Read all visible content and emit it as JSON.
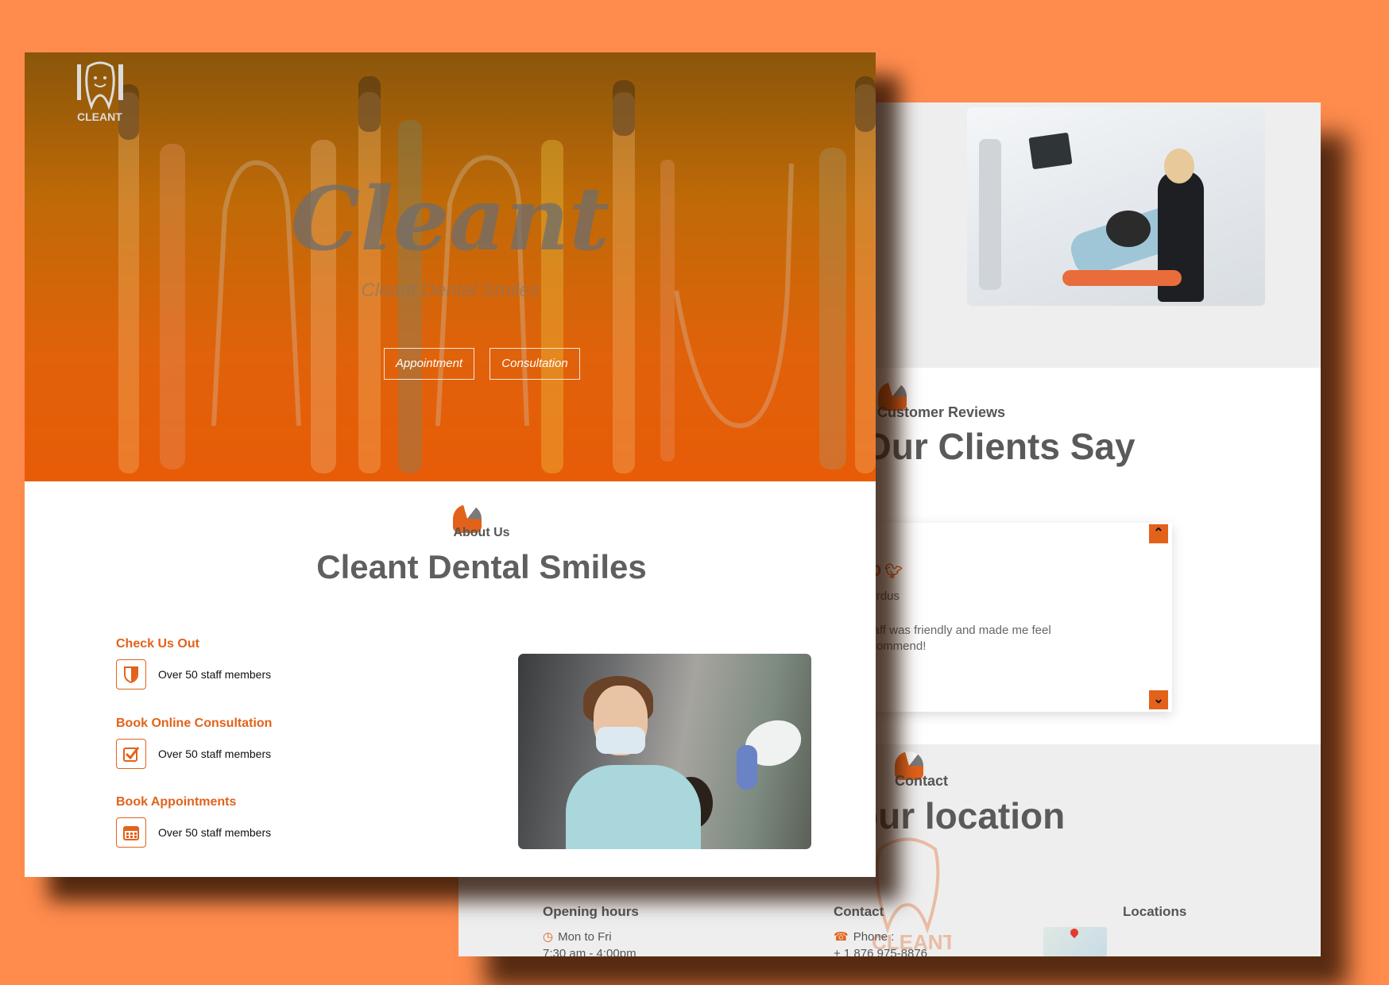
{
  "colors": {
    "background": "#ff8c4d",
    "accent": "#e2621b",
    "heading": "#5f5f5f"
  },
  "front": {
    "logo_text": "CLEANT",
    "hero": {
      "title": "Cleant",
      "subtitle": "Cleant Dental Smiles",
      "buttons": [
        "Appointment",
        "Consultation"
      ]
    },
    "about": {
      "label": "About Us",
      "title": "Cleant Dental Smiles",
      "features": [
        {
          "heading": "Check Us Out",
          "text": "Over 50 staff members",
          "icon": "shield-icon"
        },
        {
          "heading": "Book Online Consultation",
          "text": "Over 50 staff members",
          "icon": "checkbox-icon"
        },
        {
          "heading": "Book Appointments",
          "text": "Over 50 staff members",
          "icon": "calendar-icon"
        }
      ]
    }
  },
  "back": {
    "reviews": {
      "label": "Customer Reviews",
      "title": "Our Clients Say",
      "card": {
        "handle": "rD",
        "username": "ecrdus",
        "text": "staff was friendly and made me feel ecommend!"
      }
    },
    "contact": {
      "label": "Contact",
      "title": "our location",
      "columns": [
        {
          "heading": "Opening hours",
          "lines": [
            "Mon to Fri",
            "7:30 am - 4:00pm"
          ]
        },
        {
          "heading": "Contact",
          "lines": [
            "Phone :",
            "+ 1 876 975-8876"
          ]
        },
        {
          "heading": "Locations",
          "lines": []
        }
      ]
    }
  }
}
